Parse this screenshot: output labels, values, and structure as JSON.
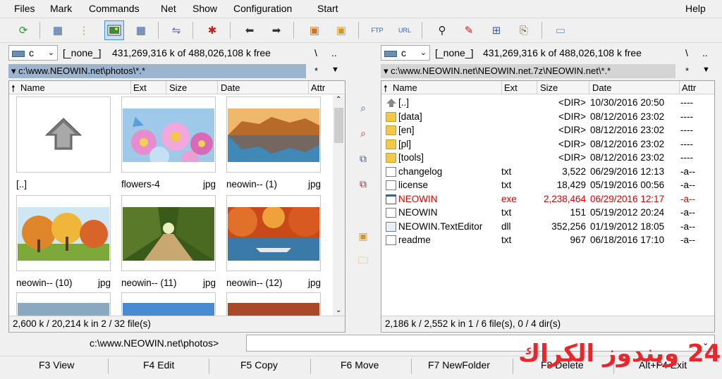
{
  "menu": [
    "Files",
    "Mark",
    "Commands",
    "Net",
    "Show",
    "Configuration",
    "Start"
  ],
  "menu_help": "Help",
  "toolbar_icons": [
    "refresh-icon",
    "brief-view-icon",
    "tree-icon",
    "thumbnail-view-icon",
    "compare-icon",
    "sync-icon",
    "target-icon",
    "back-icon",
    "forward-icon",
    "pack-icon",
    "unpack-icon",
    "ftp-connect-icon",
    "url-connect-icon",
    "search-icon",
    "rename-icon",
    "multi-rename-icon",
    "copy-names-icon",
    "notepad-icon"
  ],
  "left": {
    "drive": "c",
    "volume": "[_none_]",
    "free": "431,269,316 k of 488,026,108 k free",
    "root_btn": "\\",
    "up_btn": "..",
    "path": "c:\\www.NEOWIN.net\\photos\\*.*",
    "star": "*",
    "cols": [
      "Name",
      "Ext",
      "Size",
      "Date",
      "Attr"
    ],
    "thumbs": [
      {
        "name": "[..]",
        "ext": ""
      },
      {
        "name": "flowers-4",
        "ext": "jpg"
      },
      {
        "name": "neowin-- (1)",
        "ext": "jpg"
      },
      {
        "name": "neowin-- (10)",
        "ext": "jpg"
      },
      {
        "name": "neowin-- (11)",
        "ext": "jpg"
      },
      {
        "name": "neowin-- (12)",
        "ext": "jpg"
      }
    ],
    "status": "2,600 k / 20,214 k in 2 / 32 file(s)"
  },
  "right": {
    "drive": "c",
    "volume": "[_none_]",
    "free": "431,269,316 k of 488,026,108 k free",
    "root_btn": "\\",
    "up_btn": "..",
    "path": "c:\\www.NEOWIN.net\\NEOWIN.net.7z\\NEOWIN.net\\*.*",
    "star": "*",
    "cols": [
      "Name",
      "Ext",
      "Size",
      "Date",
      "Attr"
    ],
    "rows": [
      {
        "name": "[..]",
        "ext": "",
        "size": "<DIR>",
        "date": "10/30/2016 20:50",
        "attr": "----",
        "icon": "up-icon"
      },
      {
        "name": "[data]",
        "ext": "",
        "size": "<DIR>",
        "date": "08/12/2016 23:02",
        "attr": "----",
        "icon": "folder-icon"
      },
      {
        "name": "[en]",
        "ext": "",
        "size": "<DIR>",
        "date": "08/12/2016 23:02",
        "attr": "----",
        "icon": "folder-icon"
      },
      {
        "name": "[pl]",
        "ext": "",
        "size": "<DIR>",
        "date": "08/12/2016 23:02",
        "attr": "----",
        "icon": "folder-icon"
      },
      {
        "name": "[tools]",
        "ext": "",
        "size": "<DIR>",
        "date": "08/12/2016 23:02",
        "attr": "----",
        "icon": "folder-icon"
      },
      {
        "name": "changelog",
        "ext": "txt",
        "size": "3,522",
        "date": "06/29/2016 12:13",
        "attr": "-a--",
        "icon": "document-icon"
      },
      {
        "name": "license",
        "ext": "txt",
        "size": "18,429",
        "date": "05/19/2016 00:56",
        "attr": "-a--",
        "icon": "document-icon"
      },
      {
        "name": "NEOWIN",
        "ext": "exe",
        "size": "2,238,464",
        "date": "06/29/2016 12:17",
        "attr": "-a--",
        "icon": "exe-icon"
      },
      {
        "name": "NEOWIN",
        "ext": "txt",
        "size": "151",
        "date": "05/19/2012 20:24",
        "attr": "-a--",
        "icon": "document-icon"
      },
      {
        "name": "NEOWIN.TextEditor",
        "ext": "dll",
        "size": "352,256",
        "date": "01/19/2012 18:05",
        "attr": "-a--",
        "icon": "dll-icon"
      },
      {
        "name": "readme",
        "ext": "txt",
        "size": "967",
        "date": "06/18/2016 17:10",
        "attr": "-a--",
        "icon": "document-icon"
      }
    ],
    "status": "2,186 k / 2,552 k in 1 / 6 file(s), 0 / 4 dir(s)"
  },
  "colors": {
    "highlight_red": "#e00000",
    "active_path": "#9bb4cf",
    "watermark": "#e8262c"
  },
  "cmd_path": "c:\\www.NEOWIN.net\\photos>",
  "fkeys": [
    "F3 View",
    "F4 Edit",
    "F5 Copy",
    "F6 Move",
    "F7 NewFolder",
    "F8 Delete",
    "Alt+F4 Exit"
  ],
  "watermark": "24 ويندوز الكراك"
}
